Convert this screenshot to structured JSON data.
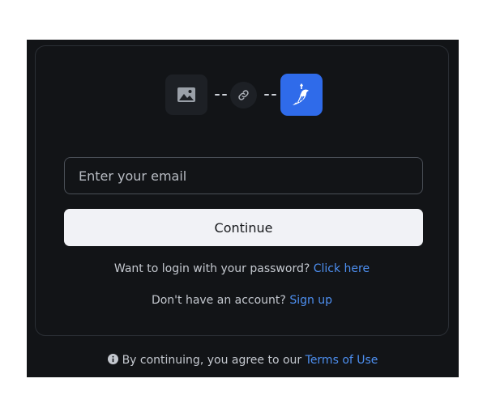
{
  "connect_header": {
    "placeholder_icon": "image-icon",
    "link_icon": "link-icon",
    "app_icon": "bird-logo-icon",
    "app_color": "#2f6bea"
  },
  "form": {
    "email_placeholder": "Enter your email",
    "email_value": "",
    "continue_label": "Continue"
  },
  "password_login": {
    "prompt": "Want to login with your password?",
    "link": "Click here"
  },
  "signup": {
    "prompt": "Don't have an account?",
    "link": "Sign up"
  },
  "footer": {
    "icon": "info-icon",
    "text": "By continuing, you agree to our",
    "terms_link": "Terms of Use"
  },
  "colors": {
    "background": "#121417",
    "accent_link": "#4d8ff0",
    "button": "#f1f2f6"
  }
}
